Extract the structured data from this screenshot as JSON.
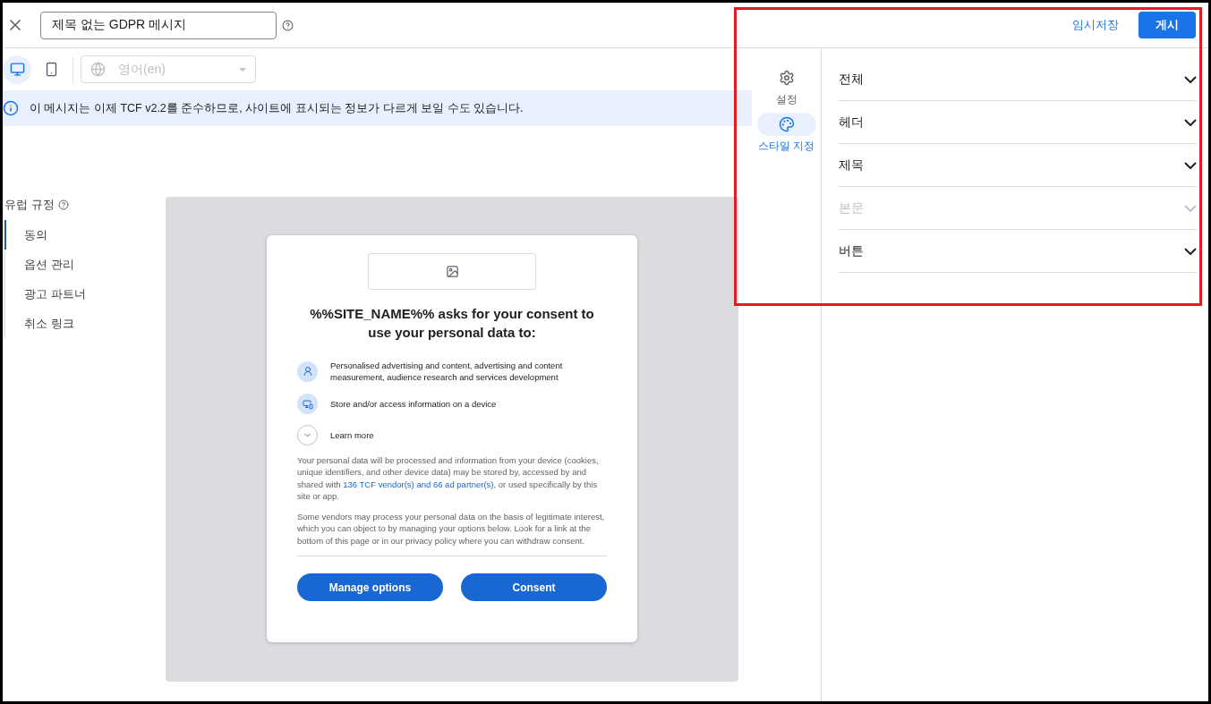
{
  "header": {
    "title_field": {
      "value": "제목 없는 GDPR 메시지"
    },
    "save_draft": "임시저장",
    "publish": "게시"
  },
  "toolbar": {
    "devices": [
      {
        "kind": "desktop",
        "selected": true
      },
      {
        "kind": "mobile",
        "selected": false
      }
    ],
    "language": {
      "value": "영어(en)",
      "disabled": true
    }
  },
  "banner": "이 메시지는 이제 TCF v2.2를 준수하므로, 사이트에 표시되는 정보가 다르게 보일 수도 있습니다.",
  "nav": {
    "title": "유럽 규정",
    "items": [
      {
        "label": "동의",
        "selected": true
      },
      {
        "label": "옵션 관리",
        "selected": false
      },
      {
        "label": "광고 파트너",
        "selected": false
      },
      {
        "label": "취소 링크",
        "selected": false
      }
    ]
  },
  "preview": {
    "heading": "%%SITE_NAME%% asks for your consent to use your personal data to:",
    "purposes": [
      {
        "kind": "person",
        "text": "Personalised advertising and content, advertising and content measurement, audience research and services development"
      },
      {
        "kind": "device",
        "text": "Store and/or access information on a device"
      }
    ],
    "learn_more": "Learn more",
    "paragraph_1": {
      "before": "Your personal data will be processed and information from your device (cookies, unique identifiers, and other device data) may be stored by, accessed by and shared with ",
      "link": "136 TCF vendor(s) and 66 ad partner(s)",
      "after": ", or used specifically by this site or app."
    },
    "paragraph_2": "Some vendors may process your personal data on the basis of legitimate interest, which you can object to by managing your options below. Look for a link at the bottom of this page or in our privacy policy where you can withdraw consent.",
    "buttons": [
      "Manage options",
      "Consent"
    ]
  },
  "rail": [
    {
      "kind": "settings",
      "label": "설정",
      "selected": false
    },
    {
      "kind": "style",
      "label": "스타일 지정",
      "selected": true
    }
  ],
  "sections": [
    {
      "label": "전체",
      "disabled": false
    },
    {
      "label": "헤더",
      "disabled": false
    },
    {
      "label": "제목",
      "disabled": false
    },
    {
      "label": "본문",
      "disabled": true
    },
    {
      "label": "버튼",
      "disabled": false
    }
  ]
}
